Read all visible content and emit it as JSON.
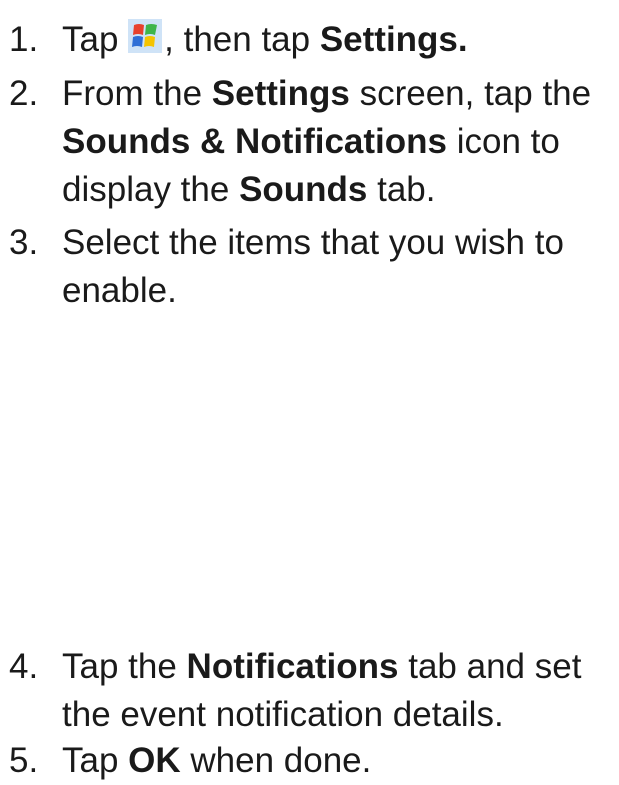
{
  "steps": [
    {
      "number": "1.",
      "parts": {
        "t1": "Tap ",
        "icon": "windows-start-icon",
        "t2": ", then tap ",
        "b1": "Settings."
      }
    },
    {
      "number": "2.",
      "parts": {
        "t1": "From the ",
        "b1": "Settings",
        "t2": " screen, tap the ",
        "b2": "Sounds & Notifications",
        "t3": " icon to display the ",
        "b3": "Sounds",
        "t4": " tab."
      }
    },
    {
      "number": "3.",
      "parts": {
        "t1": "Select the items that you wish to enable."
      }
    },
    {
      "number": "4.",
      "parts": {
        "t1": "Tap the ",
        "b1": "Notifications",
        "t2": " tab and set the event notification details."
      }
    },
    {
      "number": "5.",
      "parts": {
        "t1": "Tap ",
        "b1": "OK",
        "t2": " when done."
      }
    }
  ],
  "colors": {
    "text": "#1a1a1a",
    "icon_red": "#e8412c",
    "icon_green": "#3fb54a",
    "icon_blue": "#2f6fd6",
    "icon_yellow": "#f5c400"
  }
}
